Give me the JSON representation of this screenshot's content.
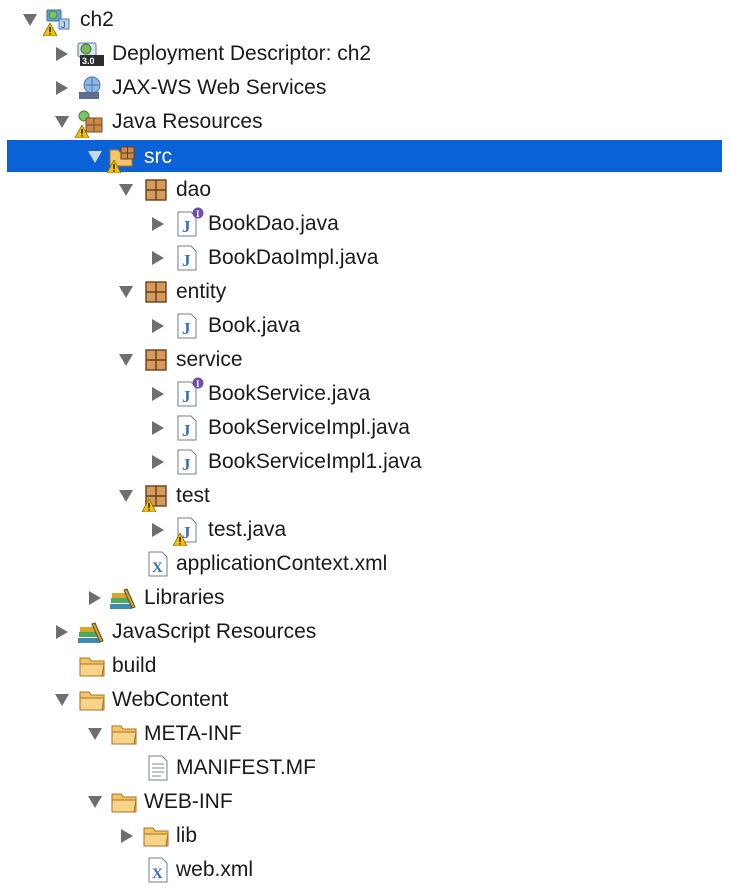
{
  "tree": {
    "items": [
      {
        "label": "ch2",
        "icon": "web-project-icon",
        "expanded": true,
        "warning": true
      },
      {
        "label": "Deployment Descriptor: ch2",
        "icon": "deployment-descriptor-icon",
        "expanded": false
      },
      {
        "label": "JAX-WS Web Services",
        "icon": "web-services-icon",
        "expanded": false
      },
      {
        "label": "Java Resources",
        "icon": "java-resources-icon",
        "expanded": true,
        "warning": true
      },
      {
        "label": "src",
        "icon": "source-folder-icon",
        "expanded": true,
        "warning": true,
        "selected": true
      },
      {
        "label": "dao",
        "icon": "package-icon",
        "expanded": true
      },
      {
        "label": "BookDao.java",
        "icon": "java-interface-file-icon",
        "expanded": false
      },
      {
        "label": "BookDaoImpl.java",
        "icon": "java-file-icon",
        "expanded": false
      },
      {
        "label": "entity",
        "icon": "package-icon",
        "expanded": true
      },
      {
        "label": "Book.java",
        "icon": "java-file-icon",
        "expanded": false
      },
      {
        "label": "service",
        "icon": "package-icon",
        "expanded": true
      },
      {
        "label": "BookService.java",
        "icon": "java-interface-file-icon",
        "expanded": false
      },
      {
        "label": "BookServiceImpl.java",
        "icon": "java-file-icon",
        "expanded": false
      },
      {
        "label": "BookServiceImpl1.java",
        "icon": "java-file-icon",
        "expanded": false
      },
      {
        "label": "test",
        "icon": "package-icon",
        "expanded": true,
        "warning": true
      },
      {
        "label": "test.java",
        "icon": "java-file-icon",
        "expanded": false,
        "warning": true
      },
      {
        "label": "applicationContext.xml",
        "icon": "xml-file-icon"
      },
      {
        "label": "Libraries",
        "icon": "libraries-icon",
        "expanded": false
      },
      {
        "label": "JavaScript Resources",
        "icon": "libraries-icon",
        "expanded": false
      },
      {
        "label": "build",
        "icon": "folder-icon"
      },
      {
        "label": "WebContent",
        "icon": "folder-icon",
        "expanded": true
      },
      {
        "label": "META-INF",
        "icon": "folder-icon",
        "expanded": true
      },
      {
        "label": "MANIFEST.MF",
        "icon": "text-file-icon"
      },
      {
        "label": "WEB-INF",
        "icon": "folder-icon",
        "expanded": true
      },
      {
        "label": "lib",
        "icon": "folder-icon",
        "expanded": false
      },
      {
        "label": "web.xml",
        "icon": "xml-file-icon"
      }
    ]
  },
  "colors": {
    "selection": "#0b62d6",
    "selection_text": "#ffffff",
    "twisty": "#6e6e6e",
    "folder": "#e8a33a",
    "package": "#8b5a2b",
    "java": "#3d6fb6",
    "warning": "#f2c200"
  }
}
